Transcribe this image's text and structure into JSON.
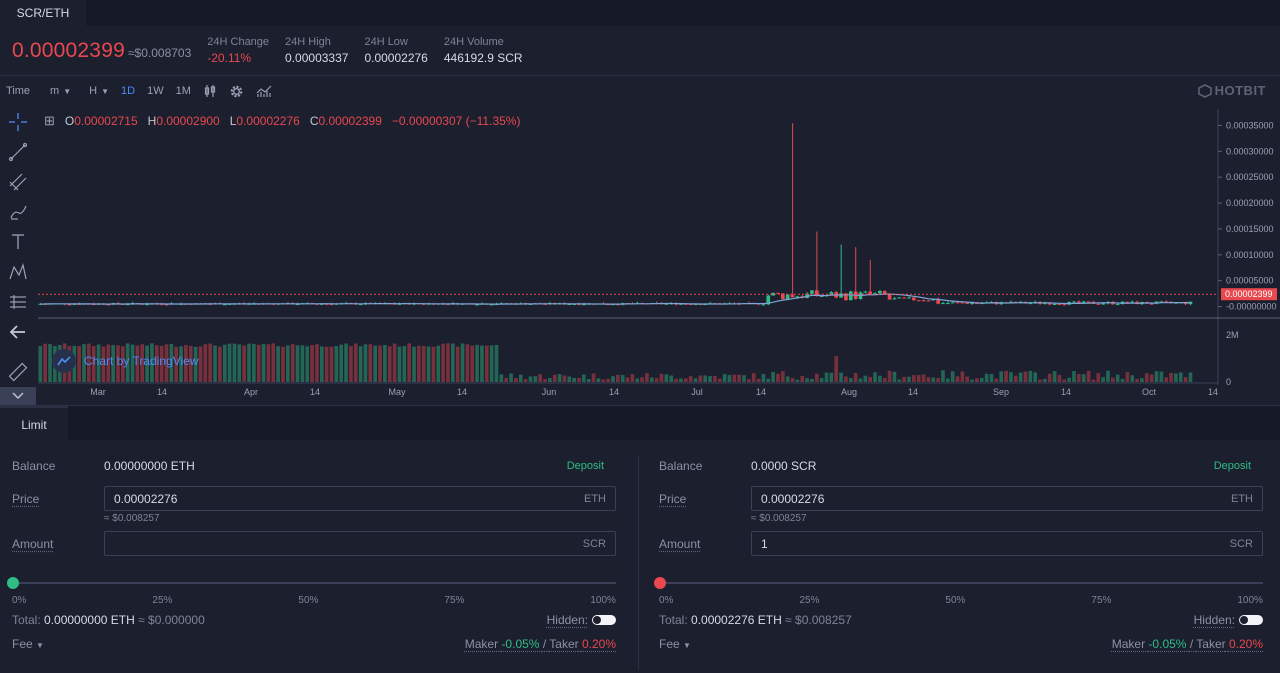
{
  "pair_tab": "SCR/ETH",
  "ticker": {
    "last_price": "0.00002399",
    "usd_approx": "≈$0.008703",
    "stats": [
      {
        "label": "24H Change",
        "value": "-20.11%",
        "negative": true
      },
      {
        "label": "24H High",
        "value": "0.00003337"
      },
      {
        "label": "24H Low",
        "value": "0.00002276"
      },
      {
        "label": "24H Volume",
        "value": "446192.9 SCR"
      }
    ]
  },
  "toolbar": {
    "time": "Time",
    "minute": "m",
    "hour": "H",
    "intervals": [
      "1D",
      "1W",
      "1M"
    ],
    "active_interval": "1D",
    "brand": "HOTBIT"
  },
  "ohlc": {
    "o_label": "O",
    "o": "0.00002715",
    "h_label": "H",
    "h": "0.00002900",
    "l_label": "L",
    "l": "0.00002276",
    "c_label": "C",
    "c": "0.00002399",
    "change": "−0.00000307 (−11.35%)"
  },
  "tv_badge": "Chart by TradingView",
  "chart_data": {
    "type": "candlestick",
    "price_ticks": [
      "0.00035000",
      "0.00030000",
      "0.00025000",
      "0.00020000",
      "0.00015000",
      "0.00010000",
      "0.00005000",
      "-0.00000000"
    ],
    "price_range": [
      -2e-05,
      0.00037
    ],
    "current_price_label": "0.00002399",
    "volume_ticks": [
      "2M",
      "0"
    ],
    "volume_range": [
      0,
      2600000
    ],
    "x_ticks": [
      "Mar",
      "14",
      "Apr",
      "14",
      "May",
      "14",
      "Jun",
      "14",
      "Jul",
      "14",
      "Aug",
      "14",
      "Sep",
      "14",
      "Oct",
      "14"
    ],
    "up_color": "#2ebd85",
    "down_color": "#e8484e",
    "ma_color": "#7da4d8"
  },
  "order_tab": "Limit",
  "buy": {
    "balance_label": "Balance",
    "balance_value": "0.00000000 ETH",
    "deposit": "Deposit",
    "price_label": "Price",
    "price_value": "0.00002276",
    "price_unit": "ETH",
    "price_usd": "≈ $0.008257",
    "amount_label": "Amount",
    "amount_value": "",
    "amount_unit": "SCR",
    "percents": [
      "0%",
      "25%",
      "50%",
      "75%",
      "100%"
    ],
    "total_label": "Total:",
    "total_value": "0.00000000 ETH",
    "total_usd": "≈ $0.000000",
    "hidden_label": "Hidden:",
    "fee_label": "Fee",
    "maker_label": "Maker",
    "maker_value": "-0.05%",
    "taker_label": "Taker",
    "taker_value": "0.20%",
    "knob_color": "#2ebd85"
  },
  "sell": {
    "balance_label": "Balance",
    "balance_value": "0.0000 SCR",
    "deposit": "Deposit",
    "price_label": "Price",
    "price_value": "0.00002276",
    "price_unit": "ETH",
    "price_usd": "≈ $0.008257",
    "amount_label": "Amount",
    "amount_value": "1",
    "amount_unit": "SCR",
    "percents": [
      "0%",
      "25%",
      "50%",
      "75%",
      "100%"
    ],
    "total_label": "Total:",
    "total_value": "0.00002276 ETH",
    "total_usd": "≈ $0.008257",
    "hidden_label": "Hidden:",
    "fee_label": "Fee",
    "maker_label": "Maker",
    "maker_value": "-0.05%",
    "taker_label": "Taker",
    "taker_value": "0.20%",
    "knob_color": "#e8484e"
  }
}
